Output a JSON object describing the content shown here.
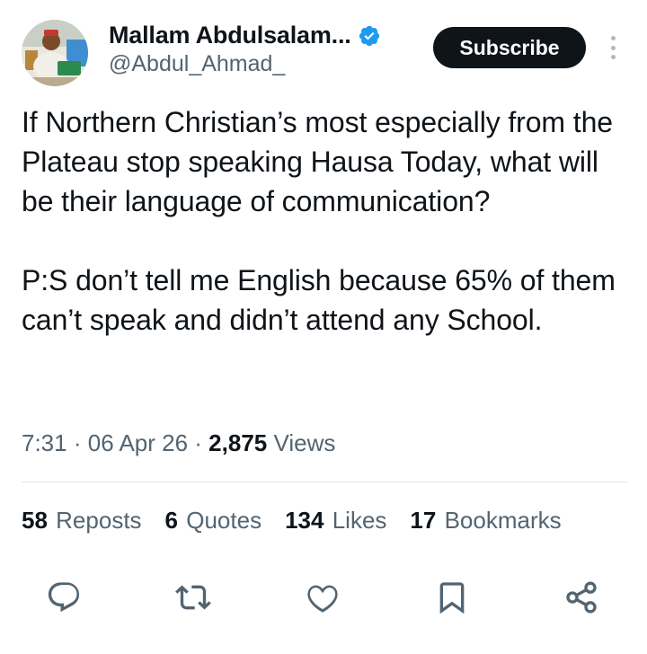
{
  "author": {
    "display_name": "Mallam Abdulsalam...",
    "handle": "@Abdul_Ahmad_",
    "avatar_icon": "profile-photo",
    "verified_icon": "verified-badge-icon"
  },
  "header": {
    "subscribe_label": "Subscribe",
    "more_icon": "more-vertical-icon"
  },
  "tweet": {
    "text": "If Northern Christian’s most especially from the Plateau stop speaking Hausa Today, what will be their language of communication?\n\nP:S don’t tell me English because 65% of them can’t speak and didn’t attend any School.",
    "time": "7:31",
    "date": "06 Apr 26",
    "views_count": "2,875",
    "views_label": "Views"
  },
  "stats": [
    {
      "count": "58",
      "label": "Reposts"
    },
    {
      "count": "6",
      "label": "Quotes"
    },
    {
      "count": "134",
      "label": "Likes"
    },
    {
      "count": "17",
      "label": "Bookmarks"
    }
  ],
  "actions": [
    "reply-icon",
    "repost-icon",
    "like-icon",
    "bookmark-icon",
    "share-icon"
  ],
  "colors": {
    "text_primary": "#0f1419",
    "text_secondary": "#536471",
    "verified_blue": "#1d9bf0",
    "subscribe_bg": "#0f1419",
    "divider": "#e4e8eb"
  }
}
